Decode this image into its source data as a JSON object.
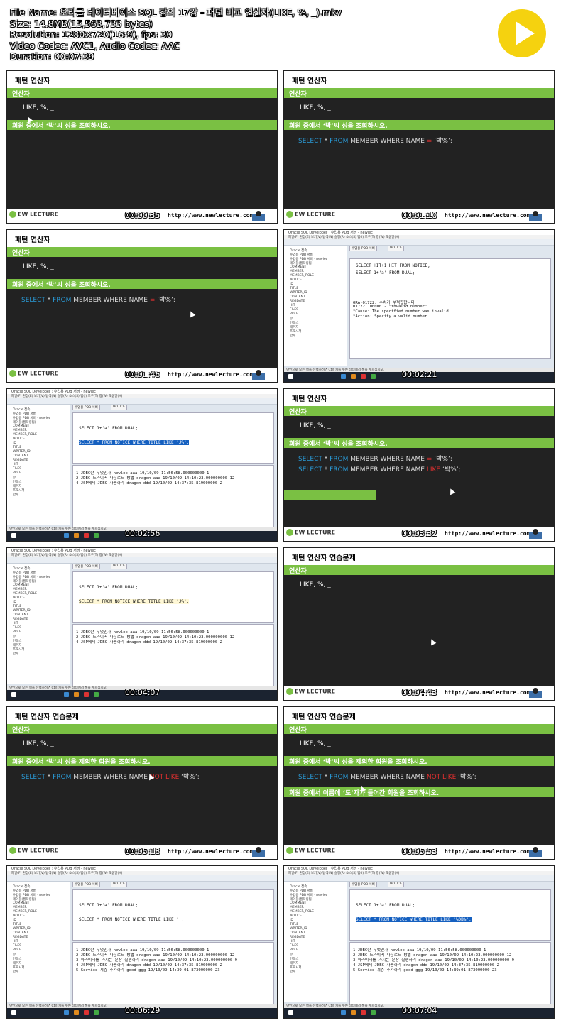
{
  "file_info": {
    "file_name": "File Name: 오라클 데이터베이스 SQL 강의 17강 - 패턴 비교 연산자(LIKE, %, _).mkv",
    "size": "Size: 14.8MB(15,563,733 bytes)",
    "resolution": "Resolution: 1280×720(16:9), fps: 30",
    "codec": "Video Codec: AVC1, Audio Codec: AAC",
    "duration": "Duration: 00:07:39"
  },
  "colors": {
    "accent_green": "#7ac043",
    "slide_bg": "#222222",
    "play_yellow": "#f5d20f",
    "keyword_blue": "#2a9ad6",
    "operator_red": "#e03030"
  },
  "play_icon": "play-icon",
  "slide_common": {
    "logo": "EW LECTURE",
    "url": "http://www.newlecture.com",
    "operator_bar": "연산자",
    "operators": "LIKE, %, _",
    "q1": "회원 중에서 ‘박’씨 성을 조회하시오.",
    "q2": "회원 중에서 ‘박’씨 성을 제외한 회원을 조회하시오.",
    "q3": "회원 중에서 이름에 ‘도’자가 들어간 회원을 조회하시오."
  },
  "sql": {
    "select": "SELECT",
    "star": "*",
    "from": "FROM",
    "rest": "MEMBER WHERE NAME",
    "eq": "=",
    "like": "LIKE",
    "notlike": "NOT LIKE",
    "val_eq": "‘박%’;",
    "val_like": "‘박%’;"
  },
  "ide_common": {
    "title": "Oracle SQL Developer : 수업용 PDB 서버 - newlec",
    "menu": "파일(F)  편집(E)  보기(V)  탐색(N)  실행(R)  소스(S)  팀(I)  도구(T)  창(W)  도움말(H)",
    "tab_conn": "수업용 PDB 서버",
    "tab_notice": "NOTICE",
    "tree": [
      "Oracle 접속",
      "수업용 PDB 서버",
      "수업용 PDB 서버 - newlec",
      "테이블(필터링됨)",
      "COMMENT",
      "MEMBER",
      "MEMBER_ROLE",
      "NOTICE",
      "ID",
      "TITLE",
      "WRITER_ID",
      "CONTENT",
      "REGDATE",
      "HIT",
      "FILES",
      "ROLE",
      "뷰",
      "인덱스",
      "패키지",
      "프로시저",
      "함수",
      "트리거",
      "큐",
      "디렉토리",
      "동의어"
    ],
    "status": "연인으로 모든 행을 선택하려면 Ctrl 키를 누른 상태에서 셀을 누르십시오.",
    "q1": "SELECT 1+'a' FROM DUAL;",
    "q_hit": "SELECT HIT+1 HIT FROM NOTICE;",
    "q_like_j": "SELECT * FROM NOTICE WHERE TITLE LIKE 'J%';",
    "q_like_e": "SELECT * FROM NOTICE WHERE TITLE LIKE '';",
    "q_like_db": "SELECT * FROM NOTICE WHERE TITLE LIKE '%DB%';",
    "err": [
      "ORA-01722: 수치가 부적합합니다",
      "01722. 00000 -  \"invalid number\"",
      "*Cause:    The specified number was invalid.",
      "*Action:   Specify a valid number."
    ],
    "rows3": [
      "1 JDBC란 무엇인가   newlec aaa  19/10/09 11:56:58.000000000  1",
      "2 JDBC 드라이버 다운로드 방법 dragon aaa 19/10/09 14:10:23.000000000 12",
      "4 JSP에서 JDBC 사용하기  dragon ddd  19/10/09 14:37:35.819000000  2"
    ],
    "rows5": [
      "1 JDBC란 무엇인가   newlec aaa  19/10/09 11:56:58.000000000  1",
      "2 JDBC 드라이버 다운로드 방법 dragon aaa 19/10/09 14:10:23.000000000 12",
      "3 파라미터를 가지는 문장 실행하기 dragon aaa 19/10/09 14:10:23.000000000 9",
      "4 JSP에서 JDBC 사용하기  dragon ddd  19/10/09 14:37:35.819000000  2",
      "5 Service 계층 추가하기  good  ggg  19/10/09 14:39:01.873000000 23"
    ]
  },
  "thumbs": [
    {
      "kind": "slide",
      "title": "패턴 연산자",
      "time": "00:00:35"
    },
    {
      "kind": "slide",
      "title": "패턴 연산자",
      "time": "00:01:10"
    },
    {
      "kind": "slide",
      "title": "패턴 연산자",
      "time": "00:01:46"
    },
    {
      "kind": "ide",
      "time": "00:02:21"
    },
    {
      "kind": "ide",
      "time": "00:02:56"
    },
    {
      "kind": "slide",
      "title": "패턴 연산자",
      "time": "00:03:32"
    },
    {
      "kind": "ide",
      "time": "00:04:07"
    },
    {
      "kind": "slide",
      "title": "패턴 연산자 연습문제",
      "time": "00:04:43"
    },
    {
      "kind": "slide",
      "title": "패턴 연산자 연습문제",
      "time": "00:05:18"
    },
    {
      "kind": "slide",
      "title": "패턴 연산자 연습문제",
      "time": "00:05:53"
    },
    {
      "kind": "ide",
      "time": "00:06:29"
    },
    {
      "kind": "ide",
      "time": "00:07:04"
    }
  ]
}
